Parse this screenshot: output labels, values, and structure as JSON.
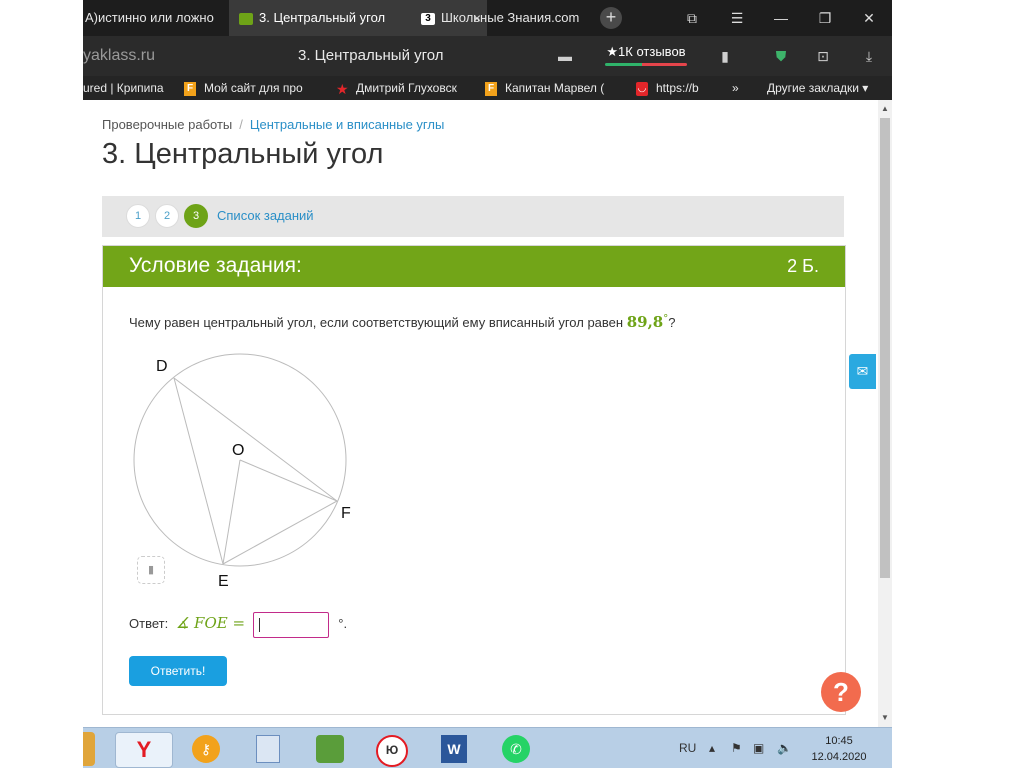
{
  "browser": {
    "tabs": [
      {
        "label": "А)истинно или ложно",
        "active": false
      },
      {
        "label": "3. Центральный угол",
        "active": true,
        "close": "×"
      },
      {
        "label": "Школьные Знания.com",
        "active": false
      }
    ],
    "new_tab": "+",
    "window_controls": [
      "⧉",
      "☰",
      "—",
      "❐",
      "✕"
    ],
    "address": {
      "domain": "yaklass.ru",
      "title": "3. Центральный угол",
      "reviews": "★1К отзывов"
    },
    "bookmarks": [
      {
        "label": "ured | Крипипа",
        "icon": "page-icon"
      },
      {
        "label": "Мой сайт для про",
        "icon": "f-icon"
      },
      {
        "label": "Дмитрий Глуховск",
        "icon": "star-icon"
      },
      {
        "label": "Капитан Марвел (",
        "icon": "f-icon"
      },
      {
        "label": "https://b",
        "icon": "bag-icon"
      }
    ],
    "bookmarks_more": "»",
    "other_bookmarks": "Другие закладки ▾"
  },
  "page": {
    "breadcrumb": {
      "root": "Проверочные работы",
      "sep": "/",
      "current": "Центральные и вписанные углы"
    },
    "title": "3. Центральный угол",
    "steps": [
      "1",
      "2",
      "3"
    ],
    "current_step": "3",
    "task_list_link": "Список заданий",
    "card": {
      "header": "Условие задания:",
      "points": "2 Б.",
      "question": "Чему равен центральный угол, если соответствующий ему вписанный угол равен",
      "value": "89,8",
      "value_unit": "°",
      "question_end": "?",
      "figure_labels": {
        "d": "D",
        "o": "O",
        "f": "F",
        "e": "E"
      },
      "answer_label": "Ответ:",
      "answer_expr": "∡ FOE =",
      "answer_unit": "°.",
      "submit": "Ответить!"
    },
    "help": "?"
  },
  "taskbar": {
    "lang": "RU",
    "time": "10:45",
    "date": "12.04.2020"
  }
}
